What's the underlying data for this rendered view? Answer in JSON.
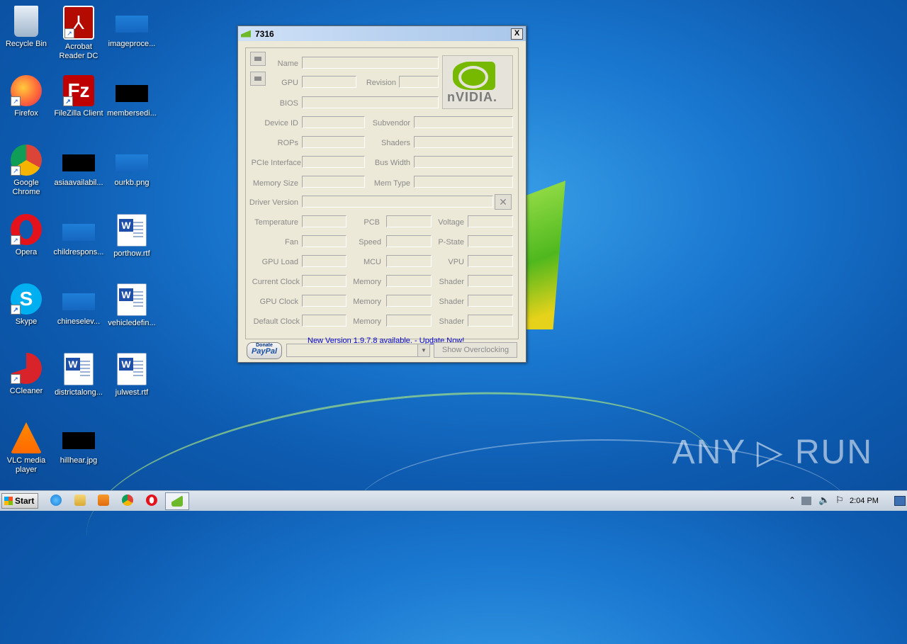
{
  "window": {
    "title": "7316",
    "close_label": "X",
    "fields": {
      "name": "Name",
      "gpu": "GPU",
      "revision": "Revision",
      "bios": "BIOS",
      "device_id": "Device ID",
      "subvendor": "Subvendor",
      "rops": "ROPs",
      "shaders": "Shaders",
      "pcie": "PCIe Interface",
      "bus_width": "Bus Width",
      "memory_size": "Memory Size",
      "mem_type": "Mem Type",
      "driver_version": "Driver Version",
      "temperature": "Temperature",
      "pcb": "PCB",
      "voltage": "Voltage",
      "fan": "Fan",
      "speed": "Speed",
      "pstate": "P-State",
      "gpu_load": "GPU Load",
      "mcu": "MCU",
      "vpu": "VPU",
      "current_clock": "Current Clock",
      "memory": "Memory",
      "shader": "Shader",
      "gpu_clock": "GPU Clock",
      "default_clock": "Default Clock"
    },
    "logo_text": "nVIDIA.",
    "update_link": "New Version 1.9.7.8 available. - Update Now!",
    "donate_label": "Donate",
    "paypal_label": "PayPal",
    "overclock_button": "Show Overclocking"
  },
  "desktop_icons": [
    {
      "label": "Recycle Bin"
    },
    {
      "label": "Acrobat Reader DC"
    },
    {
      "label": "imageproce..."
    },
    {
      "label": "Firefox"
    },
    {
      "label": "FileZilla Client"
    },
    {
      "label": "membersedi..."
    },
    {
      "label": "Google Chrome"
    },
    {
      "label": "asiaavailabil..."
    },
    {
      "label": "ourkb.png"
    },
    {
      "label": "Opera"
    },
    {
      "label": "childrespons..."
    },
    {
      "label": "porthow.rtf"
    },
    {
      "label": "Skype"
    },
    {
      "label": "chineselev..."
    },
    {
      "label": "vehicledefin..."
    },
    {
      "label": "CCleaner"
    },
    {
      "label": "districtalong..."
    },
    {
      "label": "julwest.rtf"
    },
    {
      "label": "VLC media player"
    },
    {
      "label": "hillhear.jpg"
    }
  ],
  "taskbar": {
    "start_label": "Start",
    "clock": "2:04 PM"
  },
  "watermark": "ANY ▷ RUN"
}
